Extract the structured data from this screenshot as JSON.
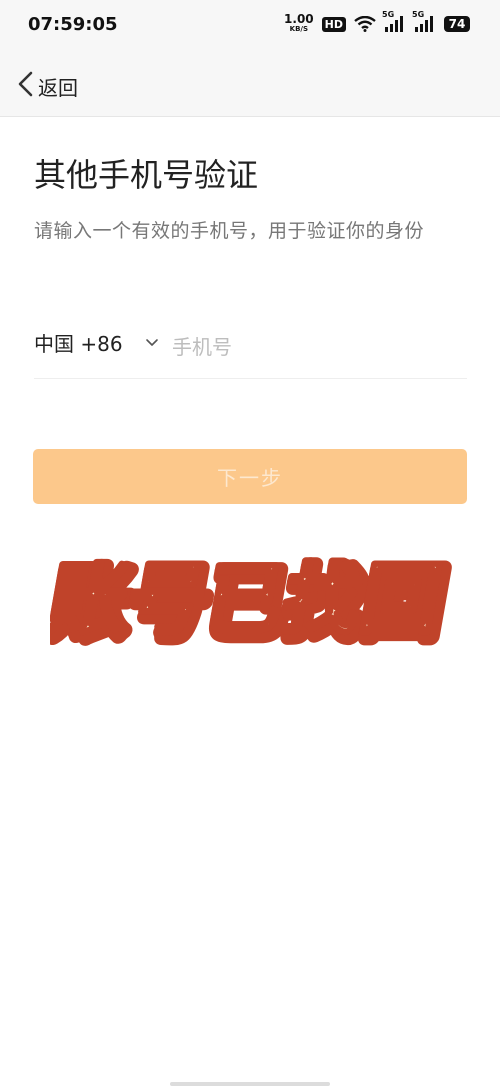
{
  "status_bar": {
    "time": "07:59:05",
    "net_speed": "1.00",
    "net_unit": "KB/S",
    "hd_label": "HD",
    "signal_label_1": "5G",
    "signal_label_2": "5G",
    "battery": "74"
  },
  "nav": {
    "back_label": "返回"
  },
  "page": {
    "title": "其他手机号验证",
    "subtitle": "请输入一个有效的手机号，用于验证你的身份"
  },
  "phone_form": {
    "country_label": "中国 +86",
    "phone_placeholder": "手机号",
    "phone_value": ""
  },
  "next_button": {
    "label": "下一步"
  },
  "overlay": {
    "text": "账号已找回"
  },
  "colors": {
    "accent_disabled": "#fcc88b",
    "overlay_fill": "#fff1d6",
    "overlay_stroke": "#c0432a"
  }
}
